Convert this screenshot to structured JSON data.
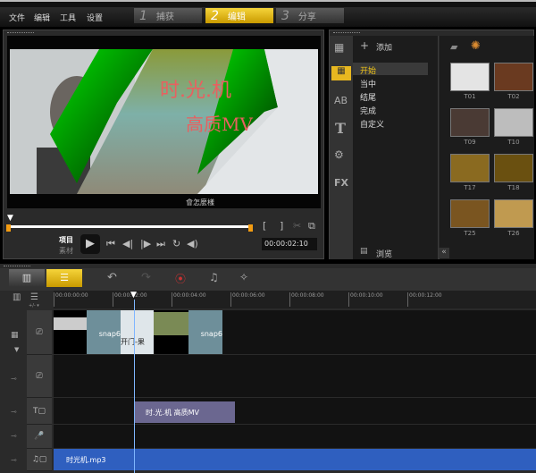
{
  "menu": {
    "items": [
      "文件",
      "编辑",
      "工具",
      "设置"
    ]
  },
  "steps": [
    {
      "num": "1",
      "label": "捕获",
      "active": false
    },
    {
      "num": "2",
      "label": "编辑",
      "active": true
    },
    {
      "num": "3",
      "label": "分享",
      "active": false
    }
  ],
  "preview": {
    "overlay_line1": "时.光.机",
    "overlay_line2": "高质MV",
    "subtitle": "會怎麼樣",
    "mode_project": "项目",
    "mode_clip": "素材",
    "timecode": "00:00:02:10",
    "mark_in": "[",
    "mark_out": "]"
  },
  "library": {
    "add_label": "添加",
    "categories": [
      "开始",
      "当中",
      "结尾",
      "完成",
      "自定义"
    ],
    "selected_category": "开始",
    "browse_label": "浏览",
    "collapse": "«",
    "thumbnails": [
      "T01",
      "T02",
      "T09",
      "T10",
      "T17",
      "T18",
      "T25",
      "T26"
    ],
    "sidebar_icons": [
      "media-icon",
      "instant-project-icon",
      "transition-icon",
      "title-icon",
      "graphic-icon",
      "filter-icon"
    ]
  },
  "timeline": {
    "ruler": [
      "00:00:00:00",
      "00:00:02:00",
      "00:00:04:00",
      "00:00:06:00",
      "00:00:08:00",
      "00:00:10:00",
      "00:00:12:00"
    ],
    "video_clips": [
      "",
      "snap6",
      "开门-果",
      "",
      "snap6"
    ],
    "title_clip": "时.光.机 高质MV",
    "music_clip": "时光机.mp3",
    "zoom_label": "+/- ▾"
  },
  "colors": {
    "accent": "#f0c419",
    "title_clip": "#6b6790",
    "music_clip": "#2f5fbf",
    "playhead": "#7fb6ff"
  }
}
